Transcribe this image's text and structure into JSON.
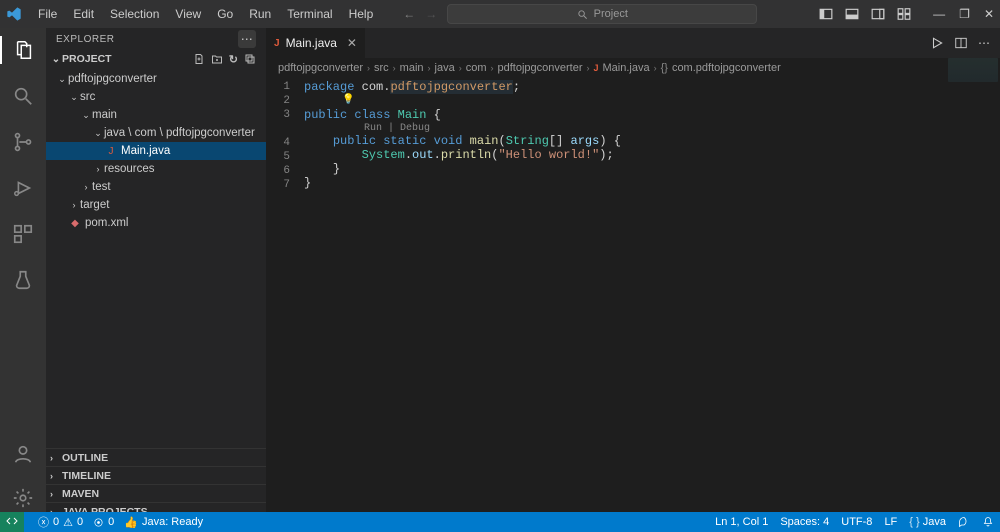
{
  "menu": {
    "file": "File",
    "edit": "Edit",
    "selection": "Selection",
    "view": "View",
    "go": "Go",
    "run": "Run",
    "terminal": "Terminal",
    "help": "Help"
  },
  "titleSearch": {
    "label": "Project"
  },
  "explorer": {
    "title": "EXPLORER"
  },
  "project": {
    "root": "PROJECT",
    "nodes": {
      "pdftojpgconverter": "pdftojpgconverter",
      "src": "src",
      "main": "main",
      "javaPath": "java \\ com \\ pdftojpgconverter",
      "mainjava": "Main.java",
      "resources": "resources",
      "test": "test",
      "target": "target",
      "pom": "pom.xml"
    }
  },
  "sidePanels": {
    "outline": "OUTLINE",
    "timeline": "TIMELINE",
    "maven": "MAVEN",
    "javaProjects": "JAVA PROJECTS"
  },
  "tab": {
    "file": "Main.java"
  },
  "breadcrumbs": {
    "p1": "pdftojpgconverter",
    "p2": "src",
    "p3": "main",
    "p4": "java",
    "p5": "com",
    "p6": "pdftojpgconverter",
    "p7": "Main.java",
    "p8": "com.pdftojpgconverter"
  },
  "codelens": {
    "text": "Run | Debug"
  },
  "code": {
    "l1a": "package",
    "l1b": " com.",
    "l1c": "pdftojpgconverter",
    "l1d": ";",
    "l3a": "public",
    "l3b": " class ",
    "l3c": "Main",
    "l3d": " {",
    "l4a": "public",
    "l4b": " static",
    "l4c": " void",
    "l4d": " main",
    "l4e": "(",
    "l4f": "String",
    "l4g": "[] ",
    "l4h": "args",
    "l4i": ") {",
    "l5a": "System",
    "l5b": ".",
    "l5c": "out",
    "l5d": ".",
    "l5e": "println",
    "l5f": "(",
    "l5g": "\"Hello world!\"",
    "l5h": ");",
    "l6": "}",
    "l7": "}"
  },
  "status": {
    "errors": "0",
    "warnings": "0",
    "ports": "0",
    "java": "Java: Ready",
    "lncol": "Ln 1, Col 1",
    "spaces": "Spaces: 4",
    "enc": "UTF-8",
    "eol": "LF",
    "lang": "Java"
  }
}
